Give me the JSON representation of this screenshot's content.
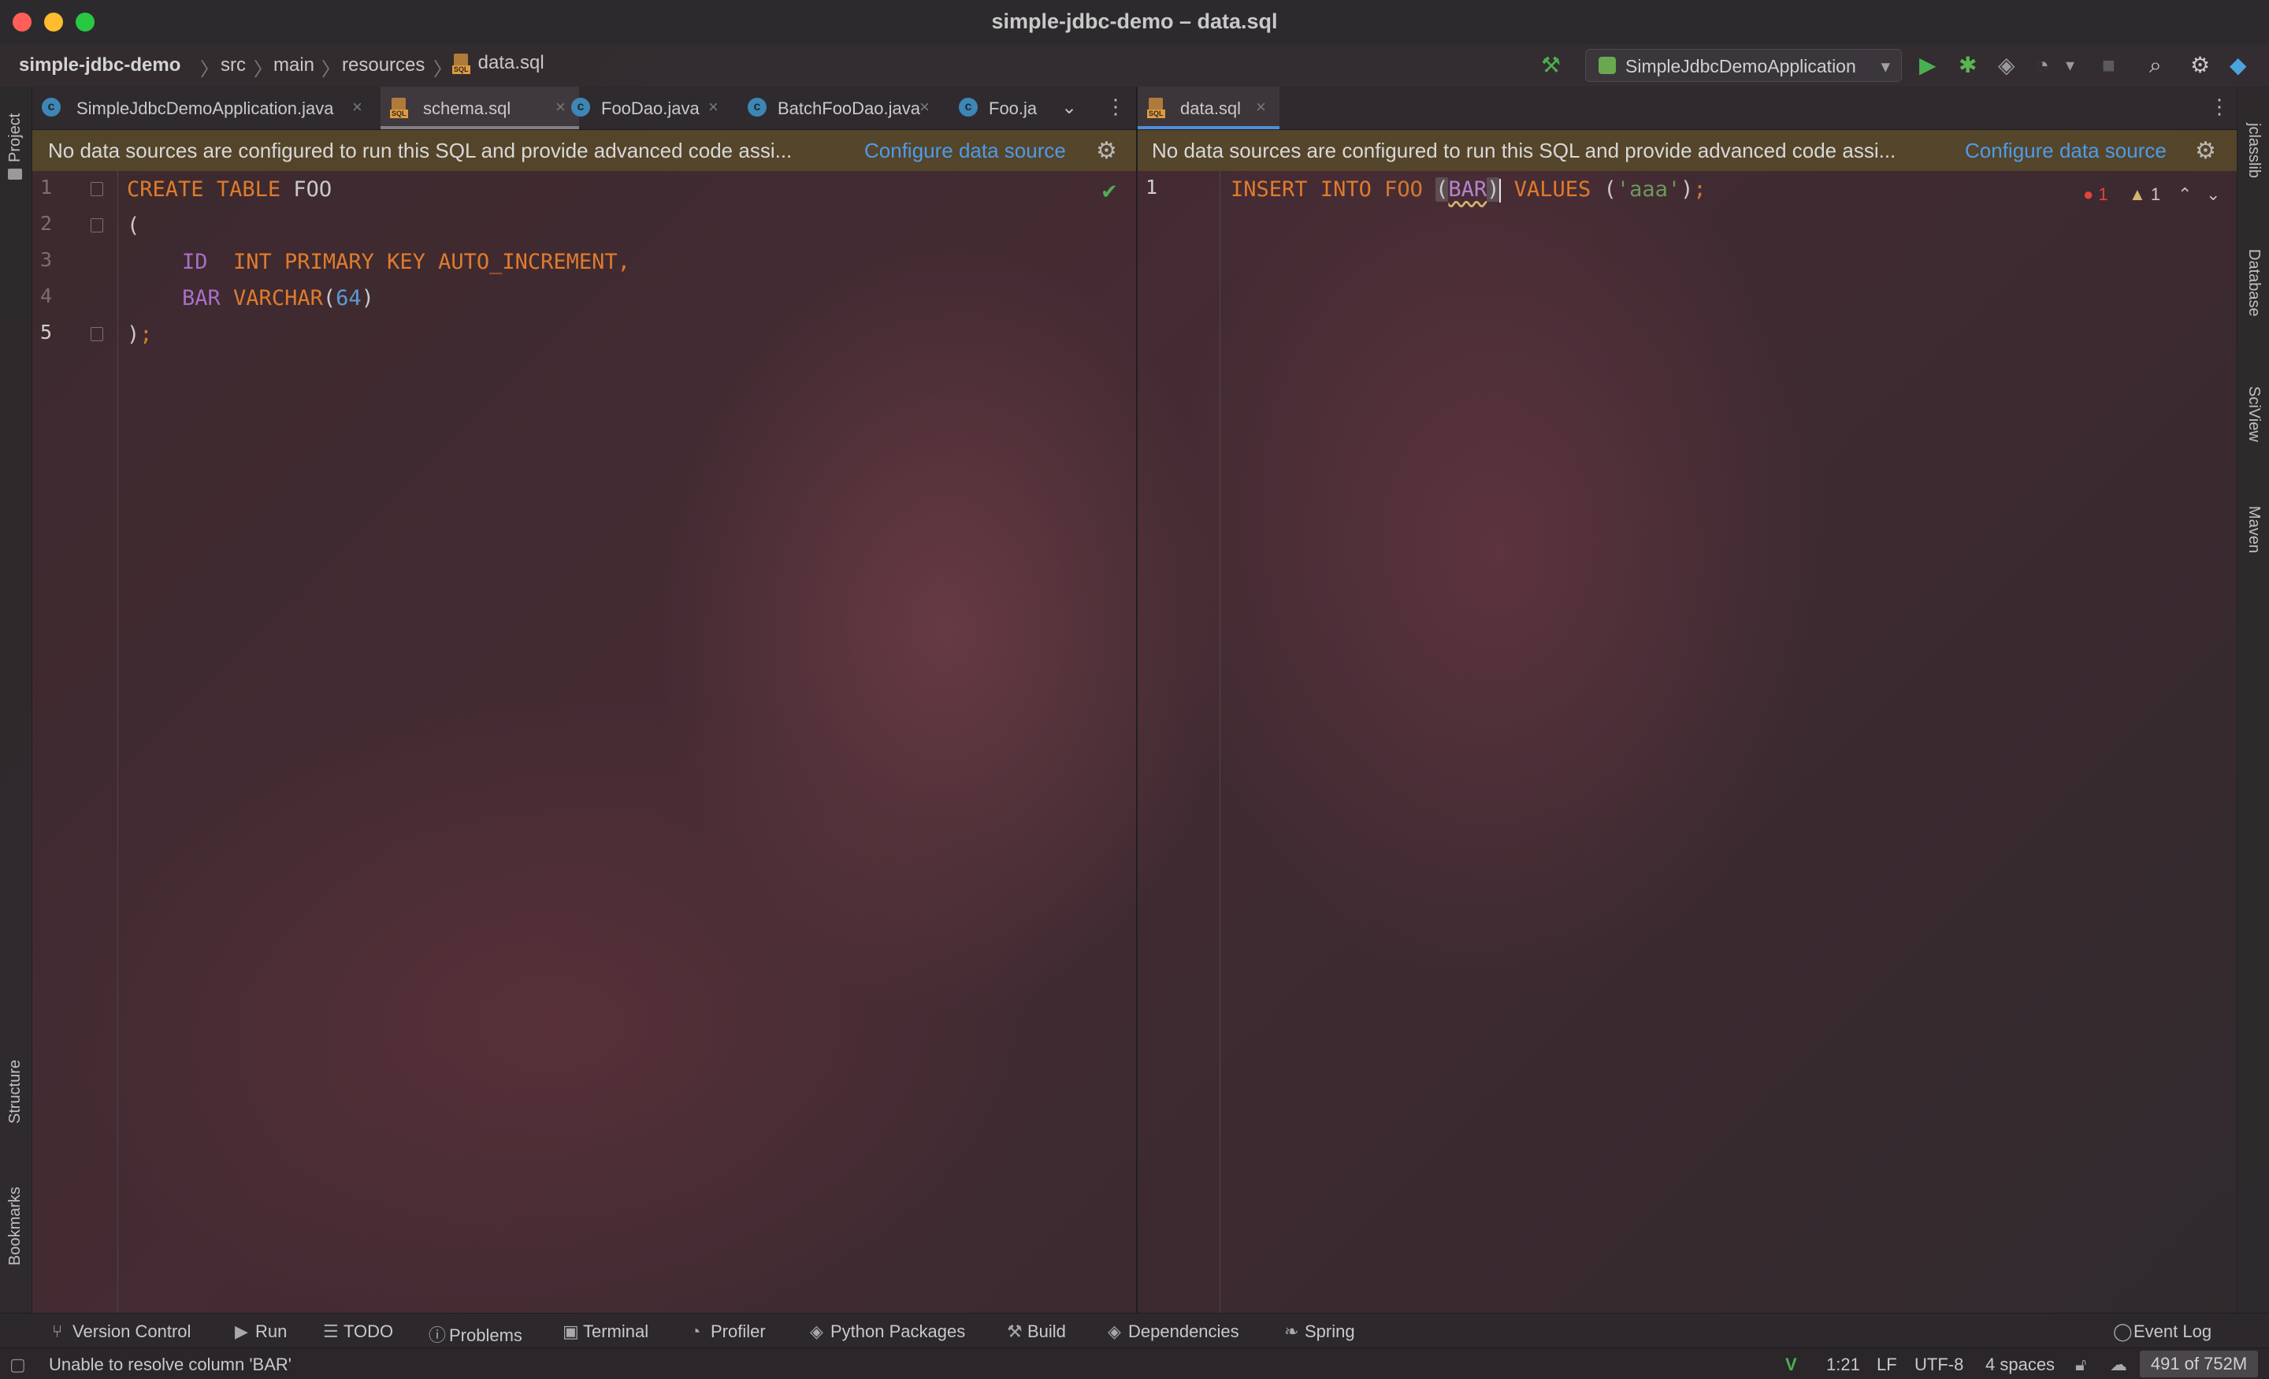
{
  "window": {
    "title": "simple-jdbc-demo – data.sql"
  },
  "navbar": {
    "breadcrumbs": [
      "simple-jdbc-demo",
      "src",
      "main",
      "resources",
      "data.sql"
    ],
    "run_config": "SimpleJdbcDemoApplication"
  },
  "left_strip": {
    "top": [
      "Project"
    ],
    "bottom": [
      "Structure",
      "Bookmarks"
    ]
  },
  "right_strip": [
    "jclasslib",
    "Database",
    "SciView",
    "Maven"
  ],
  "left_pane": {
    "tabs": [
      {
        "label": "SimpleJdbcDemoApplication.java",
        "icon": "java-class-icon"
      },
      {
        "label": "schema.sql",
        "icon": "sql-file-icon"
      },
      {
        "label": "FooDao.java",
        "icon": "java-class-icon"
      },
      {
        "label": "BatchFooDao.java",
        "icon": "java-class-icon"
      },
      {
        "label": "Foo.ja",
        "icon": "java-class-icon"
      }
    ],
    "banner": {
      "message": "No data sources are configured to run this SQL and provide advanced code assi...",
      "link": "Configure data source"
    },
    "line_numbers": [
      "1",
      "2",
      "3",
      "4",
      "5"
    ],
    "code": {
      "l1_create": "CREATE",
      "l1_table": "TABLE",
      "l1_name": "FOO",
      "l2": "(",
      "l3_id": "ID",
      "l3_rest": "INT PRIMARY KEY AUTO_INCREMENT,",
      "l4_bar": "BAR",
      "l4_type": "VARCHAR",
      "l4_open": "(",
      "l4_num": "64",
      "l4_close": ")",
      "l5_paren": ")",
      "l5_semi": ";"
    }
  },
  "right_pane": {
    "tabs": [
      {
        "label": "data.sql",
        "icon": "sql-file-icon"
      }
    ],
    "banner": {
      "message": "No data sources are configured to run this SQL and provide advanced code assi...",
      "link": "Configure data source"
    },
    "line_numbers": [
      "1"
    ],
    "code": {
      "insert": "INSERT",
      "into": "INTO",
      "table": "FOO",
      "open": "(",
      "col": "BAR",
      "close": ")",
      "values": "VALUES",
      "vopen": "(",
      "str": "'aaa'",
      "vclose": ")",
      "semi": ";"
    },
    "inspections": {
      "errors": "1",
      "warnings": "1"
    }
  },
  "bottom_tools": [
    "Version Control",
    "Run",
    "TODO",
    "Problems",
    "Terminal",
    "Profiler",
    "Python Packages",
    "Build",
    "Dependencies",
    "Spring",
    "Event Log"
  ],
  "status": {
    "message": "Unable to resolve column 'BAR'",
    "position": "1:21",
    "line_sep": "LF",
    "encoding": "UTF-8",
    "indent": "4 spaces",
    "memory": "491 of 752M"
  },
  "colors": {
    "keyword": "#e07b2c",
    "column": "#a86fc4",
    "number": "#5e9ad4",
    "string": "#6a9a5c",
    "link": "#4f9be8",
    "active_tab_underline": "#4e8ed6"
  }
}
